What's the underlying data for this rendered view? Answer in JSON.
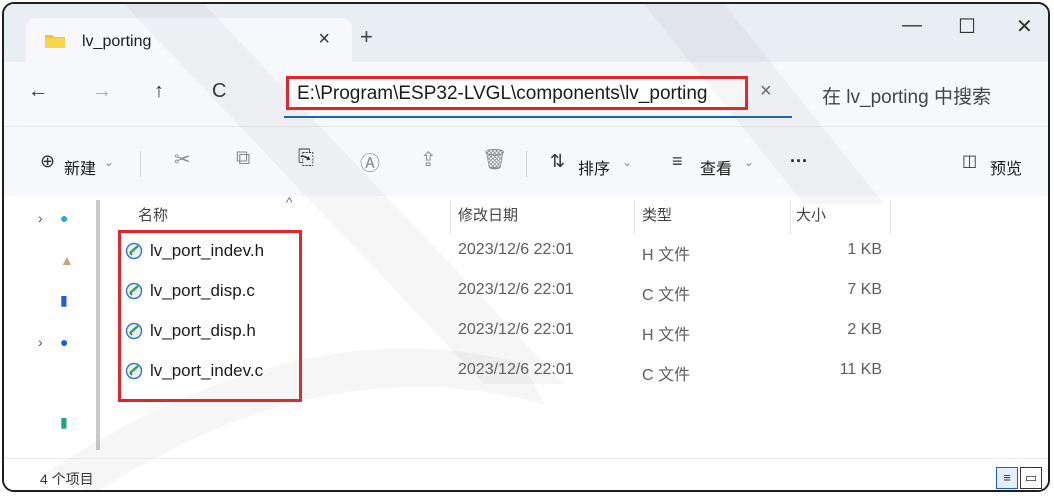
{
  "tab": {
    "title": "lv_porting",
    "close": "×",
    "new": "+"
  },
  "window": {
    "minimize": "—",
    "maximize": "☐",
    "close": "✕"
  },
  "nav": {
    "back": "←",
    "forward": "→",
    "up": "↑",
    "refresh": "C",
    "address": "E:\\Program\\ESP32-LVGL\\components\\lv_porting",
    "clear": "×",
    "search_placeholder": "在 lv_porting 中搜索"
  },
  "toolbar": {
    "new_label": "新建",
    "sort_label": "排序",
    "view_label": "查看",
    "more_label": "···",
    "preview_label": "预览"
  },
  "columns": {
    "name": "名称",
    "modified": "修改日期",
    "type": "类型",
    "size": "大小"
  },
  "files": [
    {
      "name": "lv_port_indev.h",
      "modified": "2023/12/6 22:01",
      "type": "H 文件",
      "size": "1 KB"
    },
    {
      "name": "lv_port_disp.c",
      "modified": "2023/12/6 22:01",
      "type": "C 文件",
      "size": "7 KB"
    },
    {
      "name": "lv_port_disp.h",
      "modified": "2023/12/6 22:01",
      "type": "H 文件",
      "size": "2 KB"
    },
    {
      "name": "lv_port_indev.c",
      "modified": "2023/12/6 22:01",
      "type": "C 文件",
      "size": "11 KB"
    }
  ],
  "status": {
    "item_count": "4 个项目"
  },
  "colors": {
    "highlight_red": "#e0262b",
    "accent_blue": "#1e5fbf",
    "folder_yellow": "#f4c430"
  }
}
